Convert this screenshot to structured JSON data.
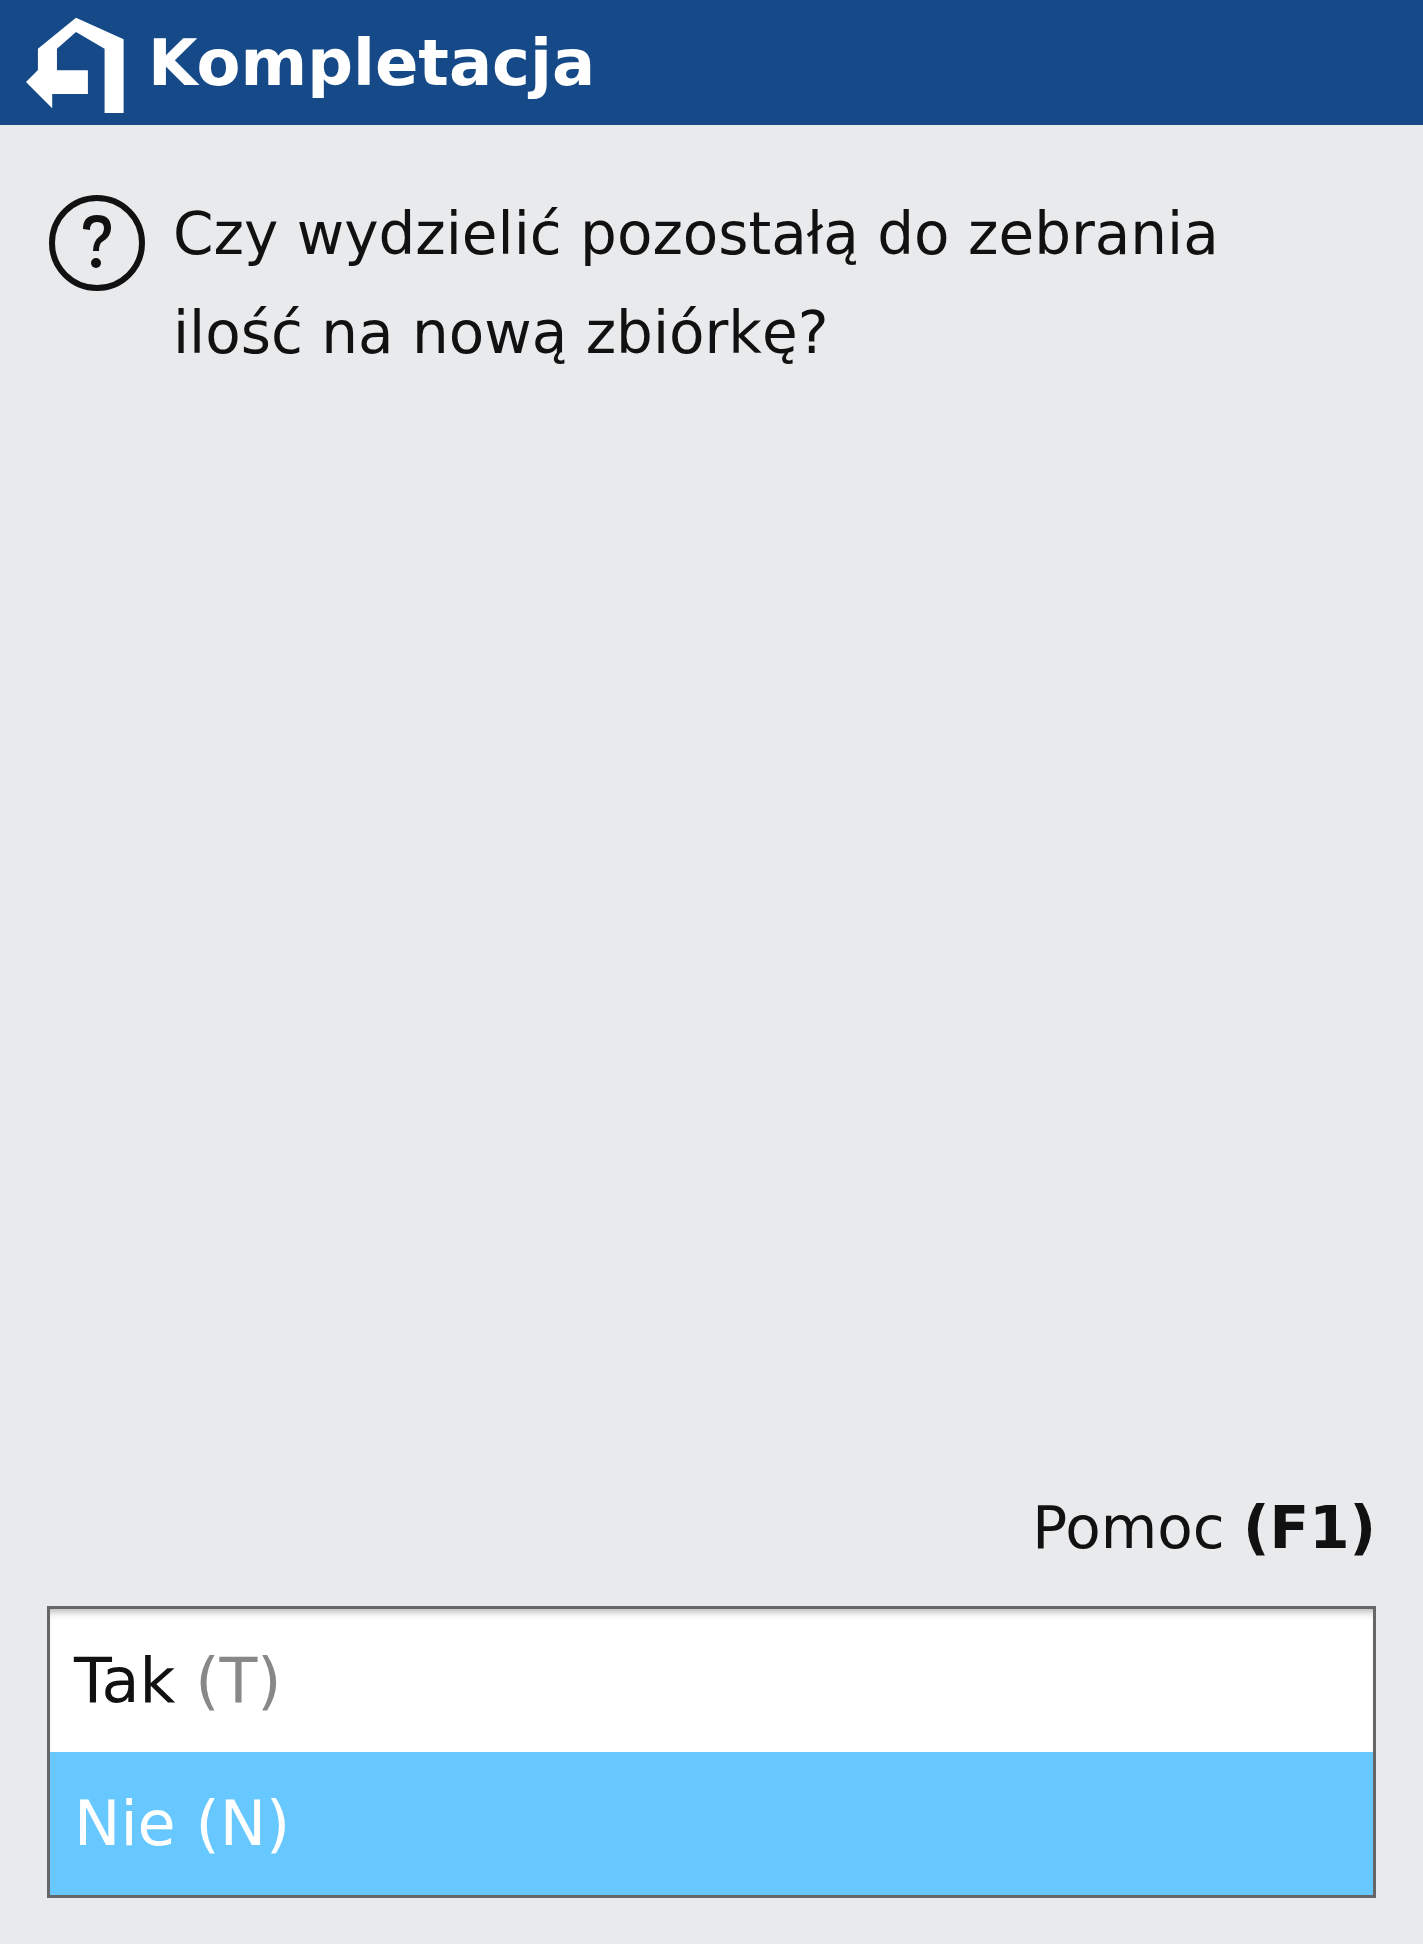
{
  "header": {
    "title": "Kompletacja"
  },
  "question": {
    "text": "Czy wydzielić pozostałą do zebrania ilość na nową zbiórkę?"
  },
  "help": {
    "text": "Pomoc **(F1)**"
  },
  "options": [
    {
      "label": "Tak",
      "key": "(T)",
      "selected": false
    },
    {
      "label": "Nie",
      "key": "(N)",
      "selected": true
    }
  ]
}
